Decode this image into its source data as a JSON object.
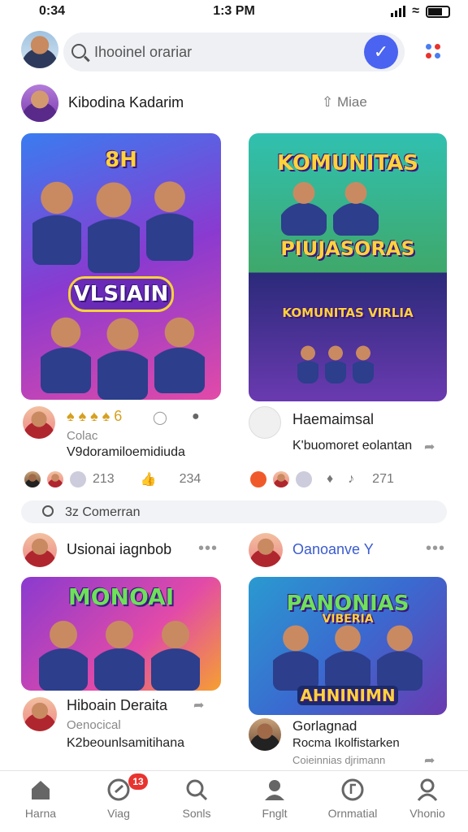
{
  "status": {
    "time_left": "0:34",
    "time_center": "1:3 PM"
  },
  "search": {
    "placeholder": "Ihooinel orariar"
  },
  "top_user": {
    "name": "Kibodina Kadarim",
    "follow": "Miae"
  },
  "cards": [
    {
      "title": "VLSIAIN",
      "headline": "8H",
      "reacts": "6",
      "sub1": "Colac",
      "sub2": "V9doramiloemidiuda"
    },
    {
      "title": "KOMUNITAS",
      "subtitle": "PIUJASORAS",
      "lower_title": "KOMUNITAS VIRLIA",
      "name": "Haemaimsal",
      "sub2": "K'buomoret eolantan"
    }
  ],
  "stats_left": {
    "a": "213",
    "b": "234"
  },
  "stats_right": {
    "a": "271"
  },
  "comment_bar": {
    "label": "3z  Comerran"
  },
  "row2_left": {
    "name": "Usionai iagnbob"
  },
  "row2_right": {
    "name": "Oanoanve Y"
  },
  "card3": {
    "title": "MONOAI",
    "name": "Hiboain Deraita",
    "sub1": "Oenocical",
    "sub2": "K2beounlsamitihana"
  },
  "card4": {
    "title": "PANONIAS",
    "title2": "VIBERIA",
    "subtitle": "AHNINIMN",
    "name": "Gorlagnad",
    "sub1": "Rocma Ikolfistarken",
    "sub2": "Coieinnias djrimann"
  },
  "tabs": [
    {
      "label": "Harna",
      "icon": "home-icon"
    },
    {
      "label": "Viag",
      "icon": "video-icon"
    },
    {
      "label": "Sonls",
      "icon": "search-icon"
    },
    {
      "label": "Fnglt",
      "icon": "profile-icon"
    },
    {
      "label": "Ornmatial",
      "icon": "music-icon"
    },
    {
      "label": "Vhonio",
      "icon": "user-icon"
    }
  ],
  "badge": "13",
  "colors": {
    "accent": "#4a63f0",
    "badge": "#e8332f"
  }
}
